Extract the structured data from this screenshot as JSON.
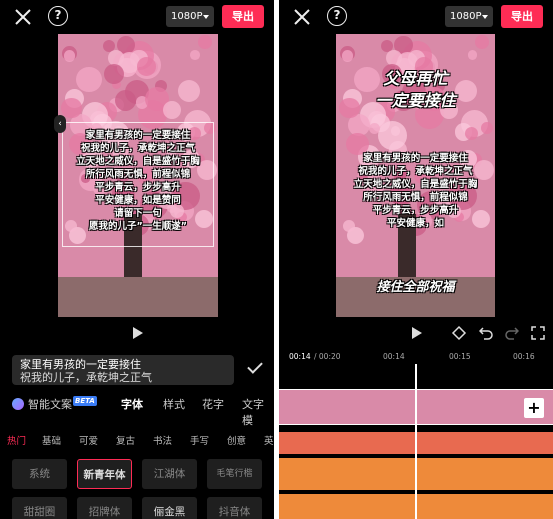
{
  "left": {
    "resolution": "1080P",
    "export_label": "导出",
    "overlay_lines": [
      "家里有男孩的一定要接住",
      "祝我的儿子，承乾坤之正气",
      "立天地之威仪，自是盛竹于胸",
      "所行风雨无惧，前程似锦",
      "平步青云，步步高升",
      "平安健康，如是赞同",
      "请留下一句",
      "愿我的儿子”一生顺遂”"
    ],
    "edit_text": "家里有男孩的一定要接住",
    "edit_text_line2": "祝我的儿子，承乾坤之正气",
    "main_tabs": [
      {
        "label": "智能文案"
      },
      {
        "label": "字体"
      },
      {
        "label": "样式"
      },
      {
        "label": "花字"
      },
      {
        "label": "文字模"
      }
    ],
    "beta_label": "BETA",
    "sub_tabs": [
      "热门",
      "基础",
      "可爱",
      "复古",
      "书法",
      "手写",
      "创意",
      "英"
    ],
    "fonts_row1": [
      "系统",
      "新青年体",
      "江湖体",
      "毛笔行楷"
    ],
    "fonts_row2": [
      "甜甜圈",
      "招牌体",
      "俪金黑",
      "抖音体"
    ]
  },
  "right": {
    "resolution": "1080P",
    "export_label": "导出",
    "title_lines": [
      "父母再忙",
      "一定要接住"
    ],
    "overlay_lines": [
      "家里有男孩的一定要接住",
      "祝我的儿子，承乾坤之正气",
      "立天地之威仪，自是盛竹于胸",
      "所行风雨无惧，前程似锦",
      "平步青云，步步高升",
      "平安健康，如"
    ],
    "bottom_caption": "接住全部祝福",
    "time_current": "00:14",
    "time_total": "/ 00:20",
    "ruler_marks": [
      "00:14",
      "00:15",
      "00:16"
    ]
  }
}
